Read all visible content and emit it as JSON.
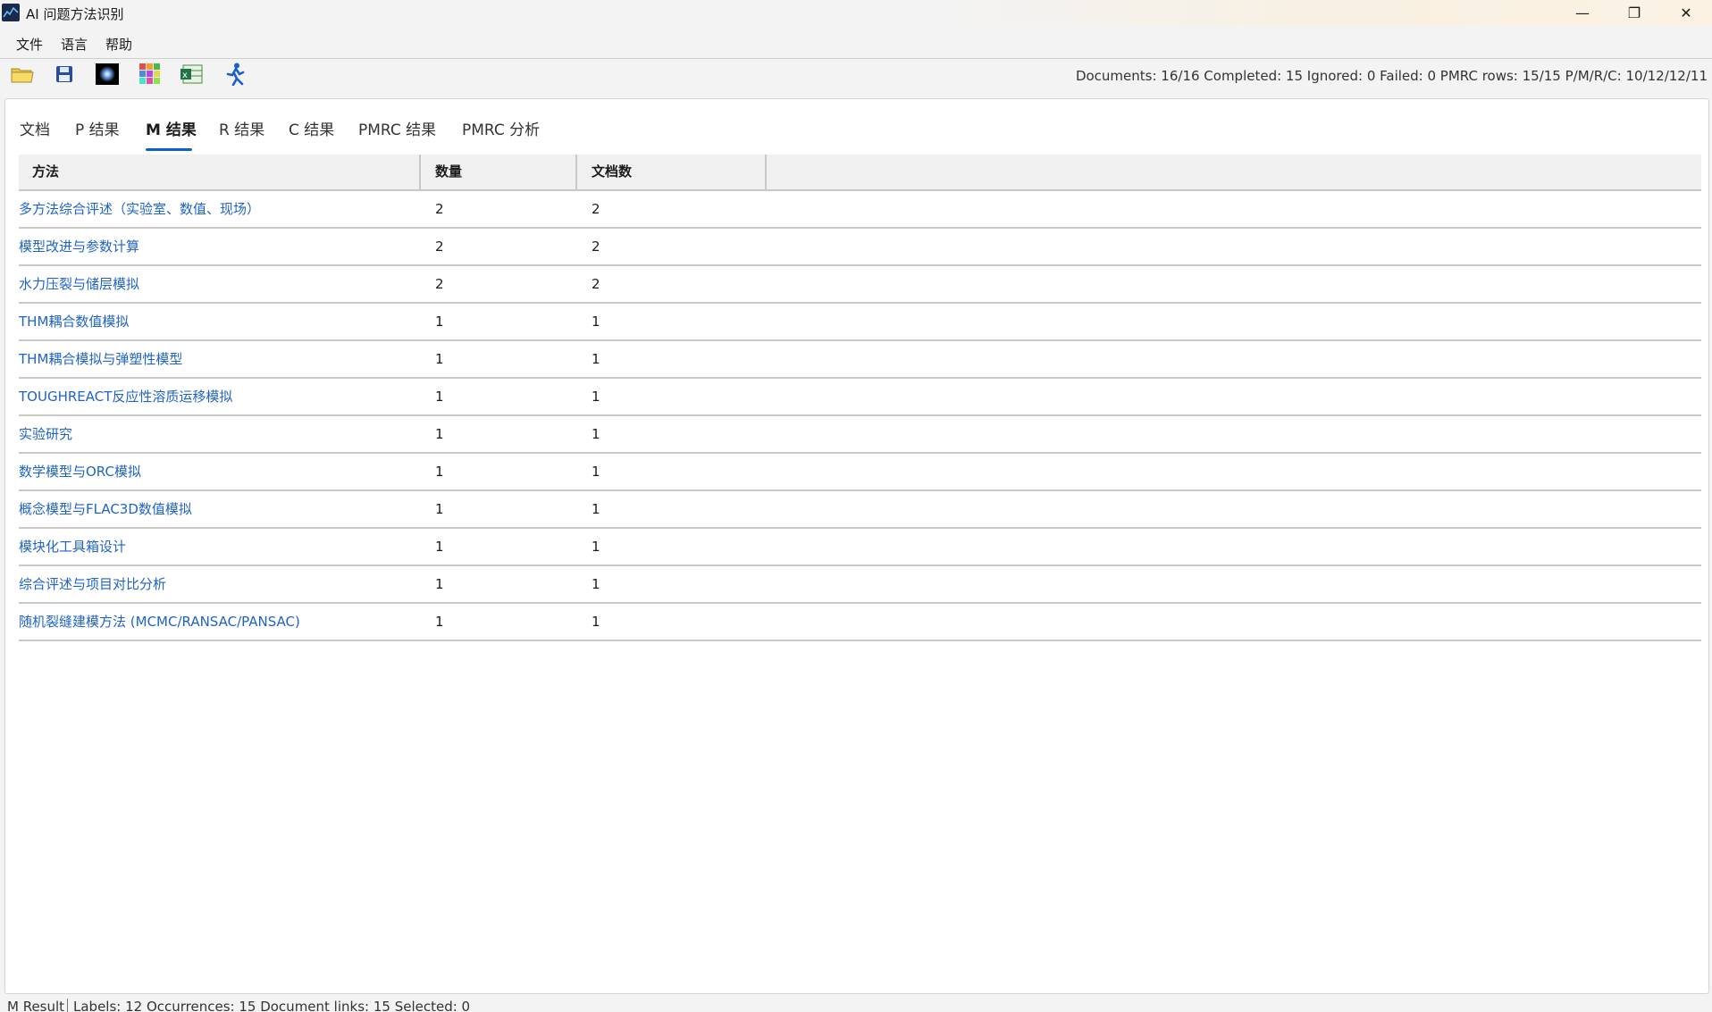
{
  "window": {
    "title": "AI 问题方法识别",
    "controls": {
      "minimize": "—",
      "maximize": "❐",
      "close": "✕"
    }
  },
  "menu": [
    "文件",
    "语言",
    "帮助"
  ],
  "toolbar": {
    "icons": [
      "open-folder-icon",
      "save-icon",
      "theme-icon",
      "grid-color-icon",
      "excel-export-icon",
      "run-icon"
    ],
    "summary": "Documents: 16/16  Completed: 15  Ignored: 0  Failed: 0  PMRC rows: 15/15  P/M/R/C: 10/12/12/11"
  },
  "tabs": [
    "文档",
    "P 结果",
    "M 结果",
    "R 结果",
    "C 结果",
    "PMRC 结果",
    "PMRC 分析"
  ],
  "active_tab": "M 结果",
  "table": {
    "headers": {
      "method": "方法",
      "count": "数量",
      "docs": "文档数"
    },
    "rows": [
      {
        "method": "多方法综合评述（实验室、数值、现场）",
        "count": "2",
        "docs": "2"
      },
      {
        "method": "模型改进与参数计算",
        "count": "2",
        "docs": "2"
      },
      {
        "method": "水力压裂与储层模拟",
        "count": "2",
        "docs": "2"
      },
      {
        "method": "THM耦合数值模拟",
        "count": "1",
        "docs": "1"
      },
      {
        "method": "THM耦合模拟与弹塑性模型",
        "count": "1",
        "docs": "1"
      },
      {
        "method": "TOUGHREACT反应性溶质运移模拟",
        "count": "1",
        "docs": "1"
      },
      {
        "method": "实验研究",
        "count": "1",
        "docs": "1"
      },
      {
        "method": "数学模型与ORC模拟",
        "count": "1",
        "docs": "1"
      },
      {
        "method": "概念模型与FLAC3D数值模拟",
        "count": "1",
        "docs": "1"
      },
      {
        "method": "模块化工具箱设计",
        "count": "1",
        "docs": "1"
      },
      {
        "method": "综合评述与项目对比分析",
        "count": "1",
        "docs": "1"
      },
      {
        "method": "随机裂缝建模方法 (MCMC/RANSAC/PANSAC)",
        "count": "1",
        "docs": "1"
      }
    ]
  },
  "statusbar": {
    "mode": "M Result",
    "details": "Labels: 12  Occurrences: 15  Document links: 15  Selected: 0"
  },
  "colors": {
    "link": "#1f63c8",
    "tab_underline": "#0a64c8"
  }
}
